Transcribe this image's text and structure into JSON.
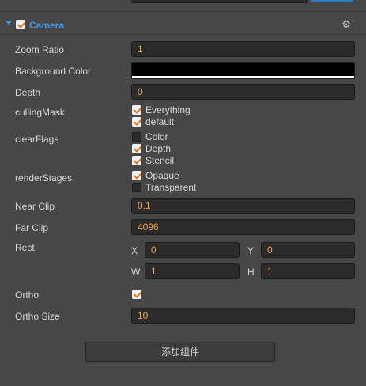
{
  "component": {
    "title": "Camera",
    "enabled": true
  },
  "icons": {
    "collapse": "triangle-down-icon",
    "settings": "gear-icon"
  },
  "properties": {
    "zoom_ratio": {
      "label": "Zoom Ratio",
      "value": "1"
    },
    "background_color": {
      "label": "Background Color",
      "value": "#000000"
    },
    "depth": {
      "label": "Depth",
      "value": "0"
    },
    "culling_mask": {
      "label": "cullingMask",
      "options": [
        {
          "label": "Everything",
          "checked": true
        },
        {
          "label": "default",
          "checked": true
        }
      ]
    },
    "clear_flags": {
      "label": "clearFlags",
      "options": [
        {
          "label": "Color",
          "checked": false
        },
        {
          "label": "Depth",
          "checked": true
        },
        {
          "label": "Stencil",
          "checked": true
        }
      ]
    },
    "render_stages": {
      "label": "renderStages",
      "options": [
        {
          "label": "Opaque",
          "checked": true
        },
        {
          "label": "Transparent",
          "checked": false
        }
      ]
    },
    "near_clip": {
      "label": "Near Clip",
      "value": "0.1"
    },
    "far_clip": {
      "label": "Far Clip",
      "value": "4096"
    },
    "rect": {
      "label": "Rect",
      "x": {
        "label": "X",
        "value": "0"
      },
      "y": {
        "label": "Y",
        "value": "0"
      },
      "w": {
        "label": "W",
        "value": "1"
      },
      "h": {
        "label": "H",
        "value": "1"
      }
    },
    "ortho": {
      "label": "Ortho",
      "checked": true
    },
    "ortho_size": {
      "label": "Ortho Size",
      "value": "10"
    }
  },
  "add_component_label": "添加组件",
  "colors": {
    "panel_bg": "#474747",
    "field_bg": "#2b2b2b",
    "value_text": "#f0a84b",
    "accent": "#3b97e8",
    "check": "#e0751f"
  }
}
